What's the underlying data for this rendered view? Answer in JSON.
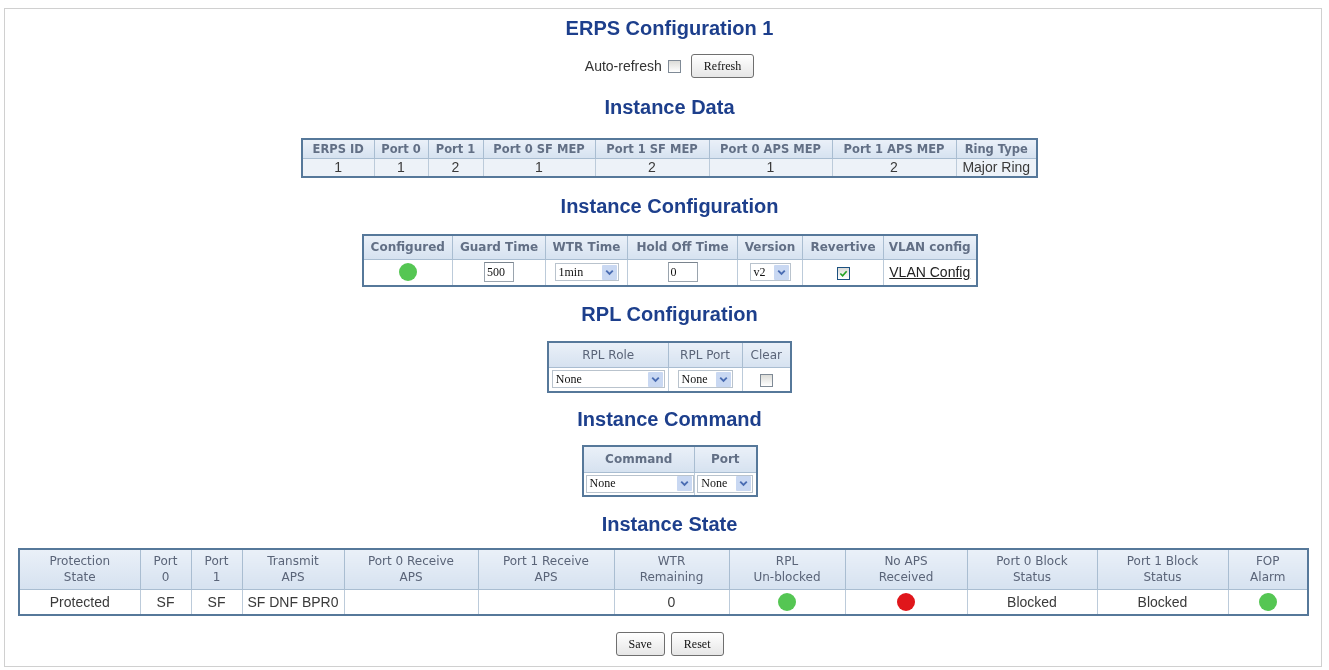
{
  "page": {
    "title": "ERPS Configuration 1"
  },
  "auto_refresh": {
    "label": "Auto-refresh",
    "checked": false,
    "button": "Refresh"
  },
  "sections": [
    {
      "heading": "Instance Data",
      "columns": [
        "ERPS ID",
        "Port 0",
        "Port 1",
        "Port 0 SF MEP",
        "Port 1 SF MEP",
        "Port 0 APS MEP",
        "Port 1 APS MEP",
        "Ring Type"
      ],
      "rows": [
        [
          {
            "kind": "text",
            "text": "1"
          },
          {
            "kind": "text",
            "text": "1"
          },
          {
            "kind": "text",
            "text": "2"
          },
          {
            "kind": "text",
            "text": "1"
          },
          {
            "kind": "text",
            "text": "2"
          },
          {
            "kind": "text",
            "text": "1"
          },
          {
            "kind": "text",
            "text": "2"
          },
          {
            "kind": "text",
            "text": "Major Ring"
          }
        ]
      ]
    },
    {
      "heading": "Instance Configuration",
      "columns": [
        "Configured",
        "Guard Time",
        "WTR Time",
        "Hold Off Time",
        "Version",
        "Revertive",
        "VLAN config"
      ],
      "rows": [
        [
          {
            "kind": "status",
            "color": "#55c653"
          },
          {
            "kind": "input",
            "value": "500"
          },
          {
            "kind": "dropdown",
            "value": "1min"
          },
          {
            "kind": "input",
            "value": "0"
          },
          {
            "kind": "dropdown",
            "value": "v2"
          },
          {
            "kind": "checkbox",
            "checked": true
          },
          {
            "kind": "link",
            "text": "VLAN Config"
          }
        ]
      ]
    },
    {
      "heading": "RPL Configuration",
      "columns": [
        "RPL Role",
        "RPL Port",
        "Clear"
      ],
      "rows": [
        [
          {
            "kind": "dropdown",
            "value": "None"
          },
          {
            "kind": "dropdown",
            "value": "None"
          },
          {
            "kind": "checkbox",
            "checked": false
          }
        ]
      ]
    },
    {
      "heading": "Instance Command",
      "columns": [
        "Command",
        "Port"
      ],
      "rows": [
        [
          {
            "kind": "dropdown",
            "value": "None"
          },
          {
            "kind": "dropdown",
            "value": "None"
          }
        ]
      ]
    },
    {
      "heading": "Instance State",
      "columns": [
        "Protection\nState",
        "Port\n0",
        "Port\n1",
        "Transmit\nAPS",
        "Port 0 Receive\nAPS",
        "Port 1 Receive\nAPS",
        "WTR\nRemaining",
        "RPL\nUn-blocked",
        "No APS\nReceived",
        "Port 0 Block\nStatus",
        "Port 1 Block\nStatus",
        "FOP\nAlarm"
      ],
      "rows": [
        [
          {
            "kind": "text",
            "text": "Protected"
          },
          {
            "kind": "text",
            "text": "SF"
          },
          {
            "kind": "text",
            "text": "SF"
          },
          {
            "kind": "text",
            "text": "SF DNF BPR0"
          },
          {
            "kind": "blank"
          },
          {
            "kind": "blank"
          },
          {
            "kind": "text",
            "text": "0"
          },
          {
            "kind": "status",
            "color": "#55c653"
          },
          {
            "kind": "status",
            "color": "#e0161b"
          },
          {
            "kind": "text",
            "text": "Blocked"
          },
          {
            "kind": "text",
            "text": "Blocked"
          },
          {
            "kind": "status",
            "color": "#55c653"
          }
        ]
      ]
    }
  ],
  "buttons": [
    "Save",
    "Reset"
  ]
}
